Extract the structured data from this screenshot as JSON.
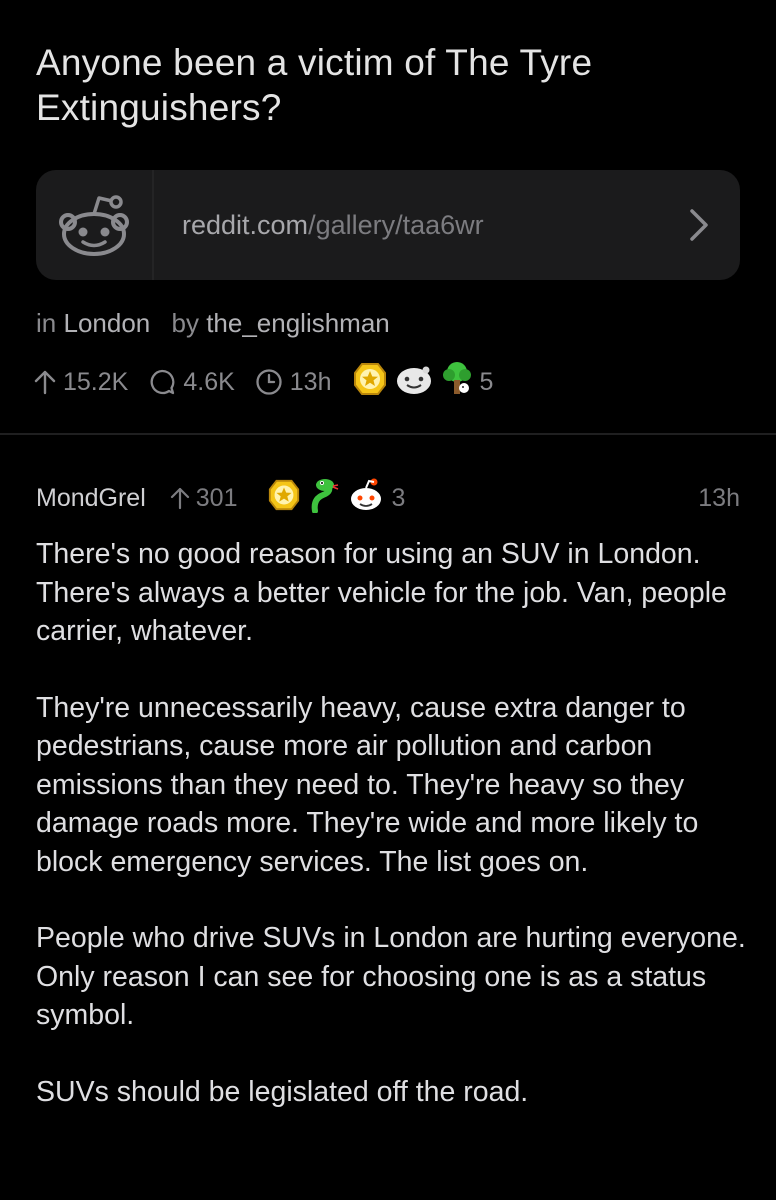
{
  "post": {
    "title": "Anyone been a victim of The Tyre Extinguishers?",
    "link": {
      "domain": "reddit.com",
      "path": "/gallery/taa6wr",
      "icon": "reddit-snoo-icon",
      "chevron_icon": "chevron-right-icon"
    },
    "meta": {
      "in_label": "in",
      "subreddit": "London",
      "by_label": "by",
      "author": "the_englishman"
    },
    "stats": {
      "upvotes": "15.2K",
      "comments": "4.6K",
      "age": "13h",
      "award_count": "5",
      "awards": [
        "helpful-award-icon",
        "wholesome-award-icon",
        "tree-hug-award-icon"
      ]
    }
  },
  "comment": {
    "author": "MondGrel",
    "score": "301",
    "award_count": "3",
    "awards": [
      "helpful-award-icon",
      "snek-award-icon",
      "snoo-award-icon"
    ],
    "age": "13h",
    "paragraphs": [
      "There's no good reason for using an SUV in London. There's always a better vehicle for the job. Van, people carrier, whatever.",
      "They're unnecessarily heavy, cause extra danger to pedestrians, cause more air pollution and carbon emissions than they need to. They're heavy so they damage roads more. They're wide and more likely to block emergency services. The list goes on.",
      "People who drive SUVs in London are hurting everyone. Only reason I can see for choosing one is as a status symbol.",
      "SUVs should be legislated off the road."
    ]
  },
  "colors": {
    "background": "#000000",
    "card": "#1b1b1c",
    "text_primary": "#dfdfe2",
    "text_secondary": "#8a8a8e",
    "award_gold": "#f5c518",
    "award_green": "#3ec23e"
  }
}
